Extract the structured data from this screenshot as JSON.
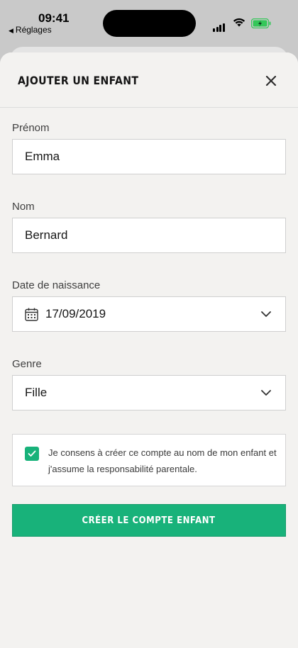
{
  "status_bar": {
    "time": "09:41",
    "back_app": "Réglages"
  },
  "sheet": {
    "title": "AJOUTER UN ENFANT"
  },
  "form": {
    "first_name": {
      "label": "Prénom",
      "value": "Emma"
    },
    "last_name": {
      "label": "Nom",
      "value": "Bernard"
    },
    "birth_date": {
      "label": "Date de naissance",
      "value": "17/09/2019"
    },
    "gender": {
      "label": "Genre",
      "value": "Fille"
    },
    "consent": {
      "checked": true,
      "text": "Je consens à créer ce compte au nom de mon enfant et j'assume la responsabilité parentale."
    },
    "submit_label": "CRÉER LE COMPTE ENFANT"
  },
  "colors": {
    "accent": "#18b27a",
    "background": "#f3f2f0",
    "battery": "#34c759"
  },
  "icons": [
    "close-icon",
    "calendar-icon",
    "chevron-down-icon",
    "checkmark-icon",
    "signal-icon",
    "wifi-icon",
    "battery-icon"
  ]
}
